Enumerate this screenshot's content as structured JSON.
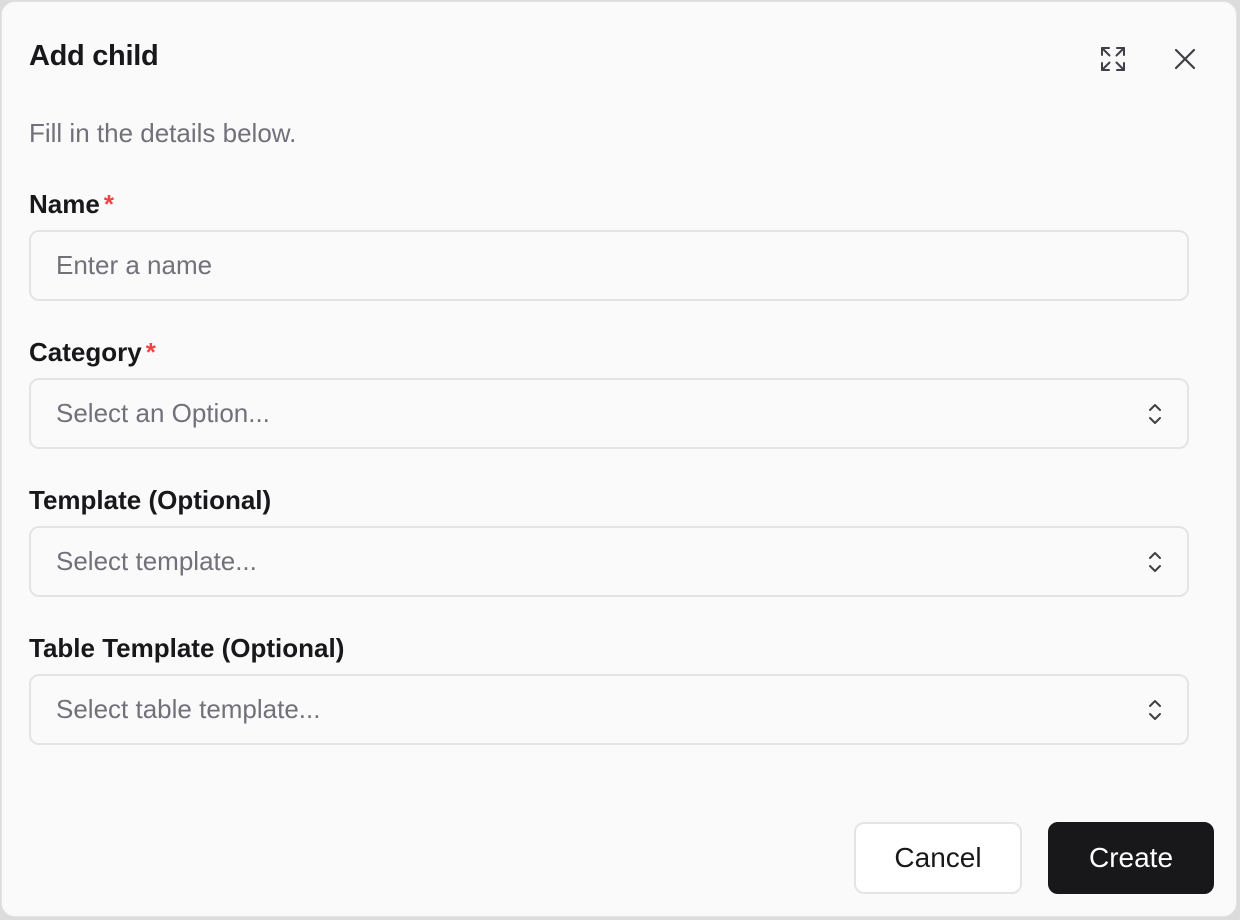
{
  "dialog": {
    "title": "Add child",
    "subtitle": "Fill in the details below.",
    "expand_icon": "expand-arrows-icon",
    "close_icon": "close-icon"
  },
  "form": {
    "name": {
      "label": "Name",
      "required_mark": "*",
      "placeholder": "Enter a name",
      "value": ""
    },
    "category": {
      "label": "Category",
      "required_mark": "*",
      "placeholder": "Select an Option..."
    },
    "template": {
      "label": "Template (Optional)",
      "placeholder": "Select template..."
    },
    "table_template": {
      "label": "Table Template (Optional)",
      "placeholder": "Select table template..."
    }
  },
  "footer": {
    "cancel_label": "Cancel",
    "create_label": "Create"
  },
  "colors": {
    "required": "#ef4444",
    "primary_button": "#18181b",
    "background": "#fafafa",
    "border": "#e4e4e7"
  }
}
